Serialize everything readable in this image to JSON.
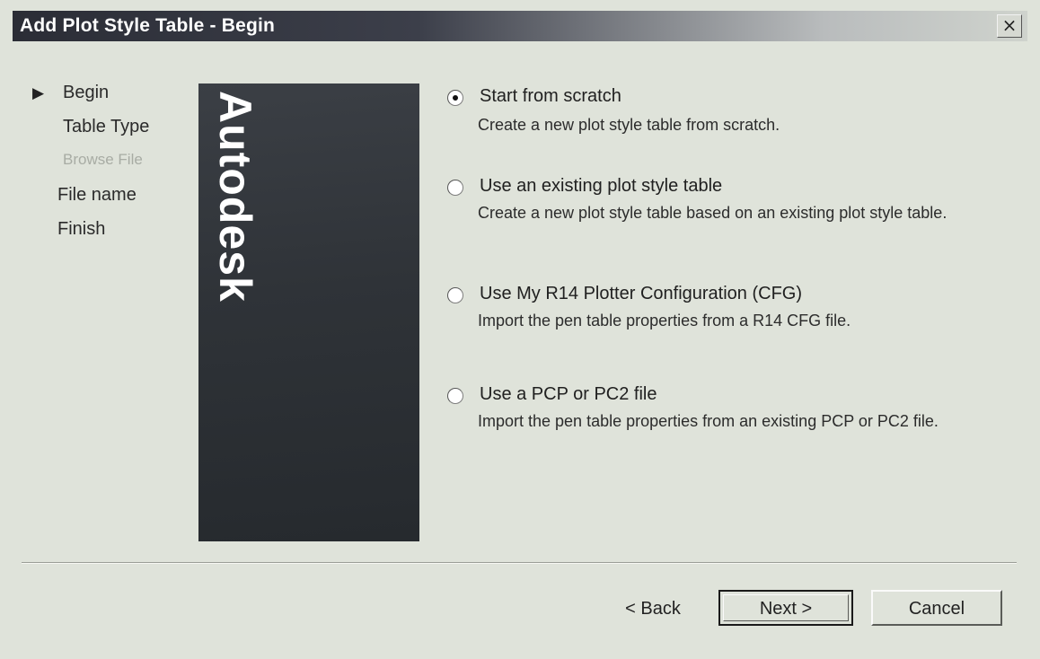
{
  "window": {
    "title": "Add Plot Style Table - Begin",
    "close_glyph": "×"
  },
  "steps": [
    {
      "label": "Begin",
      "current": true,
      "enabled": true
    },
    {
      "label": "Table Type",
      "current": false,
      "enabled": true
    },
    {
      "label": "Browse File",
      "current": false,
      "enabled": false
    },
    {
      "label": "File name",
      "current": false,
      "enabled": true
    },
    {
      "label": "Finish",
      "current": false,
      "enabled": true
    }
  ],
  "banner": {
    "text": "Autodesk"
  },
  "options": [
    {
      "label": "Start from scratch",
      "description": "Create a new plot style table from scratch.",
      "checked": true
    },
    {
      "label": "Use an existing plot style table",
      "description": "Create a new plot style table based on an existing plot style table.",
      "checked": false
    },
    {
      "label": "Use My R14 Plotter Configuration (CFG)",
      "description": "Import the pen table properties from a R14 CFG file.",
      "checked": false
    },
    {
      "label": "Use a PCP or PC2 file",
      "description": "Import the pen table properties from an existing PCP or PC2 file.",
      "checked": false
    }
  ],
  "buttons": {
    "back": "< Back",
    "next": "Next >",
    "cancel": "Cancel"
  },
  "icons": {
    "current_step": "play-arrow-icon",
    "close": "close-icon"
  }
}
